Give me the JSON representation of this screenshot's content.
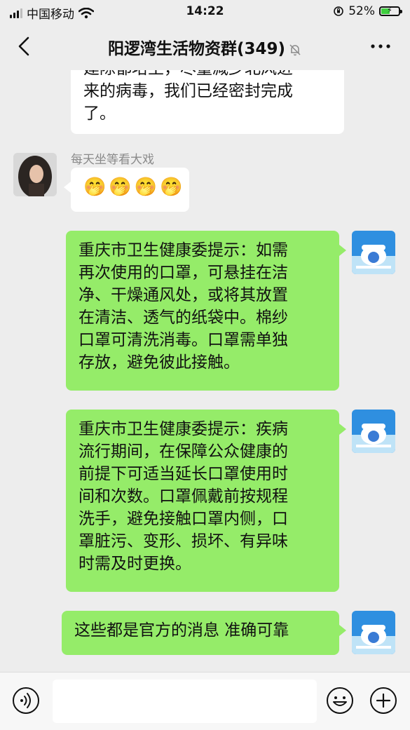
{
  "status_bar": {
    "carrier": "中国移动",
    "time": "14:22",
    "battery_percent": "52%",
    "battery_level": 0.52
  },
  "header": {
    "title": "阳逻湾生活物资群(349)"
  },
  "messages": [
    {
      "side": "in",
      "text_line1": "建除都培土，尽量减少北风进",
      "text_line2": "来的病毒，我们已经密封完成",
      "text_line3": "了。"
    },
    {
      "side": "in",
      "sender": "每天坐等看大戏",
      "emojis": [
        "🤭",
        "🤭",
        "🤭",
        "🤭"
      ]
    },
    {
      "side": "out",
      "lines": [
        "重庆市卫生健康委提示：如需",
        "再次使用的口罩，可悬挂在洁",
        "净、干燥通风处，或将其放置",
        "在清洁、透气的纸袋中。棉纱",
        "口罩可清洗消毒。口罩需单独",
        "存放，避免彼此接触。"
      ]
    },
    {
      "side": "out",
      "lines": [
        "重庆市卫生健康委提示：疾病",
        "流行期间，在保障公众健康的",
        "前提下可适当延长口罩使用时",
        "间和次数。口罩佩戴前按规程",
        "洗手，避免接触口罩内侧，口",
        "罩脏污、变形、损坏、有异味",
        "时需及时更换。"
      ]
    },
    {
      "side": "out",
      "lines": [
        "这些都是官方的消息 准确可靠"
      ]
    }
  ],
  "colors": {
    "background": "#ededed",
    "outgoing_bubble": "#95ec69",
    "incoming_bubble": "#ffffff"
  },
  "icons": {
    "back": "chevron-left-icon",
    "mute": "bell-off-icon",
    "more": "more-dots-icon",
    "voice": "voice-icon",
    "emoji": "emoji-icon",
    "add": "plus-icon"
  }
}
